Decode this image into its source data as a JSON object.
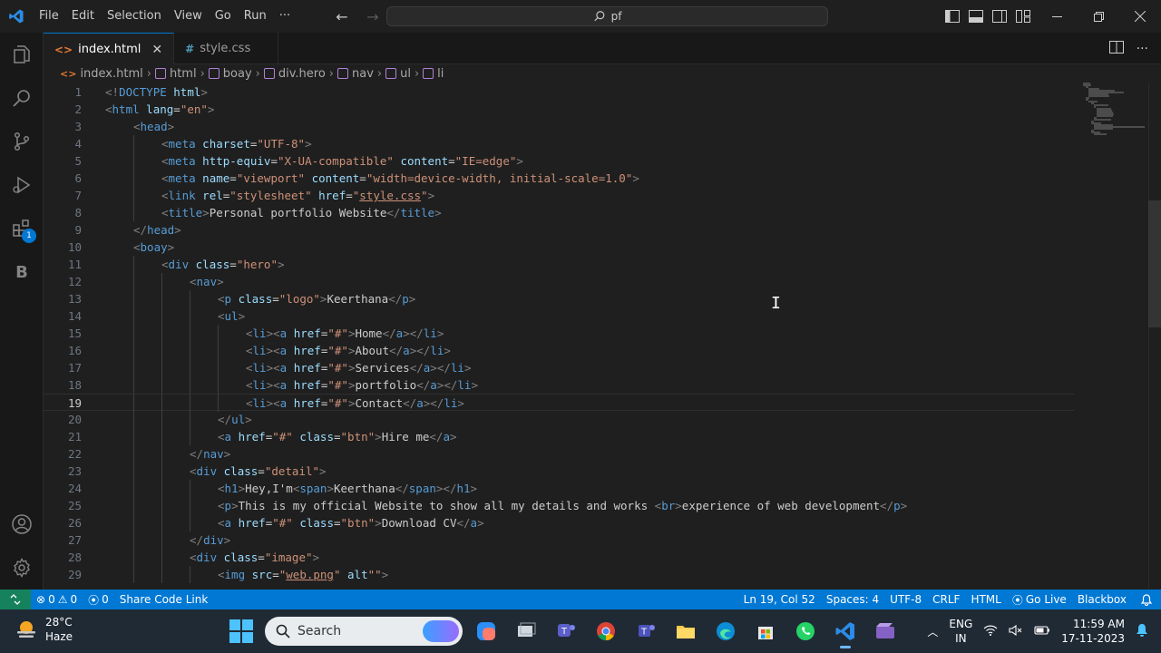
{
  "menu": [
    "File",
    "Edit",
    "Selection",
    "View",
    "Go",
    "Run",
    "···"
  ],
  "search": {
    "text": "pf"
  },
  "tabs": [
    {
      "icon": "<>",
      "label": "index.html",
      "close": "✕"
    },
    {
      "icon": "#",
      "label": "style.css"
    }
  ],
  "breadcrumb": [
    "index.html",
    "html",
    "boay",
    "div.hero",
    "nav",
    "ul",
    "li"
  ],
  "activity_badge": "1",
  "activity_letter": "B",
  "code": [
    "<!DOCTYPE html>",
    "<html lang=\"en\">",
    "<head>",
    "<meta charset=\"UTF-8\">",
    "<meta http-equiv=\"X-UA-compatible\" content=\"IE=edge\">",
    "<meta name=\"viewport\" content=\"width=device-width, initial-scale=1.0\">",
    "<link rel=\"stylesheet\" href=\"style.css\">",
    "<title>Personal portfolio Website</title>",
    "</head>",
    "<boay>",
    "<div class=\"hero\">",
    "<nav>",
    "<p class=\"logo\">Keerthana</p>",
    "<ul>",
    "<li><a href=\"#\">Home</a></li>",
    "<li><a href=\"#\">About</a></li>",
    "<li><a href=\"#\">Services</a></li>",
    "<li><a href=\"#\">portfolio</a></li>",
    "<li><a href=\"#\">Contact</a></li>",
    "</ul>",
    "<a href=\"#\" class=\"btn\">Hire me</a>",
    "</nav>",
    "<div class=\"detail\">",
    "<h1>Hey,I'm<span>Keerthana</span></h1>",
    "<p>This is my official Website to show all my details and works <br>experience of web development</p>",
    "<a href=\"#\" class=\"btn\">Download CV</a>",
    "</div>",
    "<div class=\"image\">",
    "<img src=\"web.png\" alt\"\">"
  ],
  "code_indent": [
    0,
    0,
    1,
    2,
    2,
    2,
    2,
    2,
    1,
    1,
    2,
    3,
    4,
    4,
    5,
    5,
    5,
    5,
    5,
    4,
    4,
    3,
    3,
    4,
    4,
    4,
    3,
    3,
    4
  ],
  "current_line": 19,
  "status": {
    "errors": "0",
    "warnings": "0",
    "ports": "0",
    "share": "Share Code Link",
    "position": "Ln 19, Col 52",
    "spaces": "Spaces: 4",
    "encoding": "UTF-8",
    "eol": "CRLF",
    "language": "HTML",
    "golive": "Go Live",
    "blackbox": "Blackbox"
  },
  "taskbar": {
    "temp": "28°C",
    "condition": "Haze",
    "search_placeholder": "Search",
    "lang1": "ENG",
    "lang2": "IN",
    "time": "11:59 AM",
    "date": "17-11-2023"
  },
  "colors": {
    "accent": "#0078d4",
    "tag": "#569cd6",
    "attr": "#9cdcfe",
    "string": "#ce9178",
    "bracket": "#808080"
  }
}
